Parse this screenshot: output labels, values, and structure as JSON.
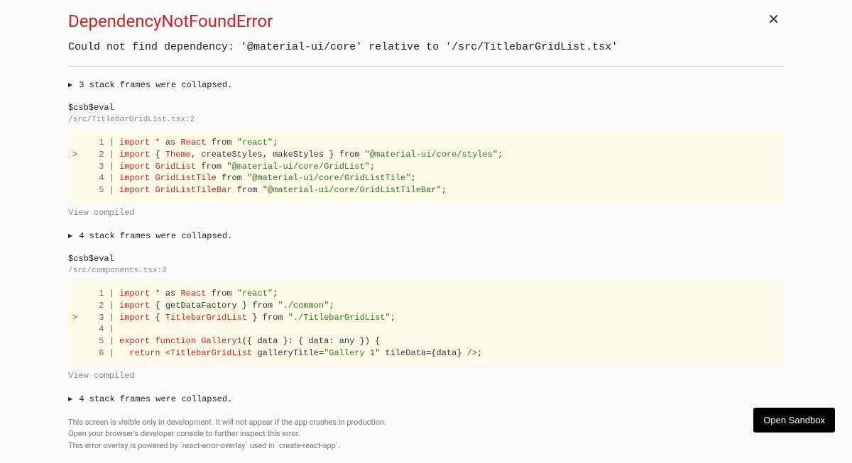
{
  "title": "DependencyNotFoundError",
  "message": "Could not find dependency: '@material-ui/core' relative to '/src/TitlebarGridList.tsx'",
  "collapsed1": "3 stack frames were collapsed.",
  "frame1": {
    "title": "$csb$eval",
    "loc": "/src/TitlebarGridList.tsx:2",
    "viewCompiled": "View compiled"
  },
  "collapsed2": "4 stack frames were collapsed.",
  "frame2": {
    "title": "$csb$eval",
    "loc": "/src/components.tsx:3",
    "viewCompiled": "View compiled"
  },
  "collapsed3": "4 stack frames were collapsed.",
  "footer": {
    "l1": "This screen is visible only in development. It will not appear if the app crashes in production.",
    "l2": "Open your browser's developer console to further inspect this error.",
    "l3": "This error overlay is powered by `react-error-overlay` used in `create-react-app`."
  },
  "buttons": {
    "close": "✕",
    "openSandbox": "Open Sandbox"
  },
  "code1": {
    "l1": {
      "n": "1",
      "imp": "import",
      "star": "*",
      "as": "as",
      "react": "React",
      "from": "from",
      "str": "\"react\"",
      "semi": ";"
    },
    "l2": {
      "g": ">",
      "n": "2",
      "imp": "import",
      "lb": "{",
      "c1": "Theme",
      "comma1": ",",
      "c2": " createStyles",
      "comma2": ",",
      "c3": " makeStyles",
      "rb": "}",
      "from": "from",
      "str": "\"@material-ui/core/styles\"",
      "semi": ";"
    },
    "l3": {
      "n": "3",
      "imp": "import",
      "name": "GridList",
      "from": "from",
      "str": "\"@material-ui/core/GridList\"",
      "semi": ";"
    },
    "l4": {
      "n": "4",
      "imp": "import",
      "name": "GridListTile",
      "from": "from",
      "str": "\"@material-ui/core/GridListTile\"",
      "semi": ";"
    },
    "l5": {
      "n": "5",
      "imp": "import",
      "name": "GridListTileBar",
      "from": "from",
      "str": "\"@material-ui/core/GridListTileBar\"",
      "semi": ";"
    }
  },
  "code2": {
    "l1": {
      "n": "1",
      "imp": "import",
      "star": "*",
      "as": "as",
      "react": "React",
      "from": "from",
      "str": "\"react\"",
      "semi": ";"
    },
    "l2": {
      "n": "2",
      "imp": "import",
      "lb": "{",
      "c1": "getDataFactory",
      "rb": "}",
      "from": "from",
      "str": "\"./common\"",
      "semi": ";"
    },
    "l3": {
      "g": ">",
      "n": "3",
      "imp": "import",
      "lb": "{",
      "c1": "TitlebarGridList",
      "rb": "}",
      "from": "from",
      "str": "\"./TitlebarGridList\"",
      "semi": ";"
    },
    "l4": {
      "n": "4"
    },
    "l5": {
      "n": "5",
      "exp": "export",
      "fn": "function",
      "name": "Gallery1",
      "rest": "({ data }: { data: any }) {"
    },
    "l6": {
      "n": "6",
      "ret": "  return",
      "tag": "<TitlebarGridList",
      "attr1": " galleryTitle=",
      "s1": "\"Gallery 1\"",
      "attr2": " tileData={data}",
      "close": " />;"
    }
  }
}
